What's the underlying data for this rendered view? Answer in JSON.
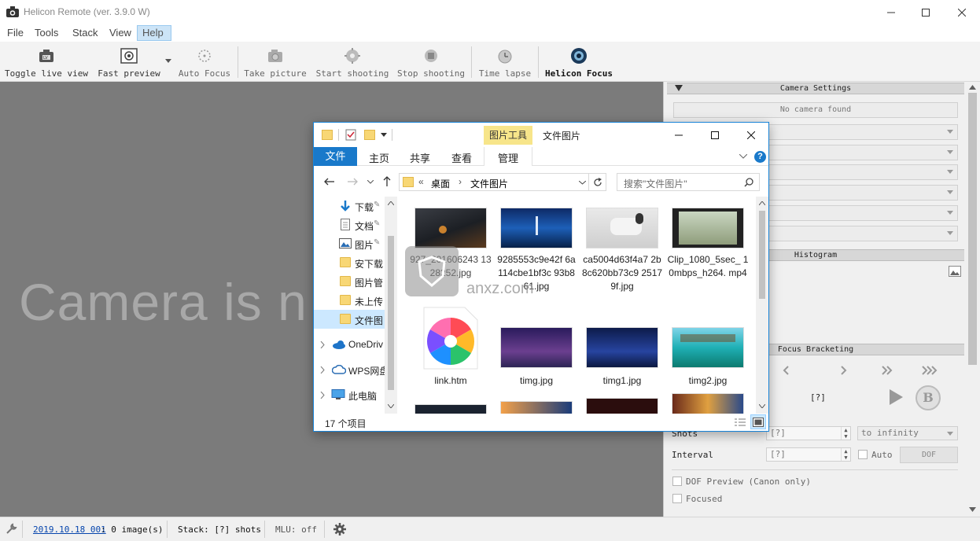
{
  "app": {
    "title": "Helicon Remote (ver. 3.9.0 W)",
    "menu": [
      "File",
      "Tools",
      "Stack",
      "View",
      "Help"
    ]
  },
  "toolbar": {
    "toggle_live_view": "Toggle live view",
    "fast_preview": "Fast preview",
    "auto_focus": "Auto Focus",
    "take_picture": "Take picture",
    "start_shooting": "Start shooting",
    "stop_shooting": "Stop shooting",
    "time_lapse": "Time lapse",
    "helicon_focus": "Helicon Focus"
  },
  "main": {
    "message": "Camera is n"
  },
  "panel": {
    "camera_settings": "Camera Settings",
    "no_camera": "No camera found",
    "histogram": "Histogram",
    "focus_bracketing": "Focus Bracketing",
    "fb_value": "[?]",
    "b_button": "B",
    "shots_label": "Shots",
    "shots_value": "[?]",
    "shots_mode": "to infinity",
    "interval_label": "Interval",
    "interval_value": "[?]",
    "auto_label": "Auto",
    "dof_button": "DOF",
    "dof_preview": "DOF Preview (Canon only)",
    "focused": "Focused"
  },
  "status": {
    "date_link": "2019.10.18 001",
    "images": ": 0 image(s)",
    "stack": "Stack: [?] shots",
    "mlu": "MLU: off"
  },
  "explorer": {
    "title": "文件图片",
    "tools_tab": "图片工具",
    "tabs": {
      "file": "文件",
      "home": "主页",
      "share": "共享",
      "view": "查看",
      "manage": "管理"
    },
    "path": {
      "chevron": "«",
      "desktop": "桌面",
      "folder": "文件图片"
    },
    "search_placeholder": "搜索\"文件图片\"",
    "tree": [
      "下载",
      "文档",
      "图片",
      "安下载",
      "图片管",
      "未上传",
      "文件图",
      "OneDriv",
      "WPS网盘",
      "此电脑"
    ],
    "files": [
      "927_201606243 1328252.jpg",
      "9285553c9e42f 6a114cbe1bf3c 93b861.jpg",
      "ca5004d63f4a7 2b8c620bb73c9 25179f.jpg",
      "Clip_1080_5sec_ 10mbps_h264. mp4",
      "link.htm",
      "timg.jpg",
      "timg1.jpg",
      "timg2.jpg"
    ],
    "item_count": "17 个项目"
  },
  "watermark": "anxz.com"
}
